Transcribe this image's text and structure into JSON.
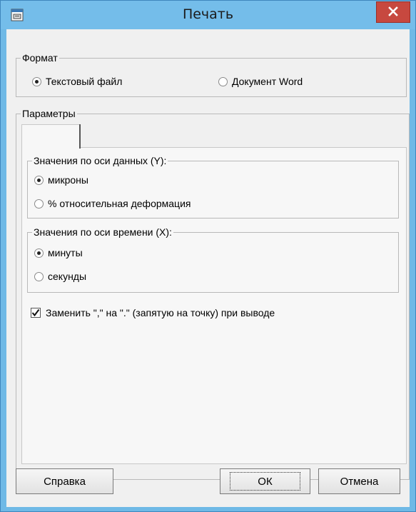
{
  "window": {
    "title": "Печать",
    "icon": "print-dialog-icon",
    "close_icon": "close-icon"
  },
  "format": {
    "legend": "Формат",
    "options": [
      {
        "label": "Текстовый файл",
        "checked": true
      },
      {
        "label": "Документ Word",
        "checked": false
      }
    ]
  },
  "params": {
    "legend": "Параметры",
    "y_group": {
      "legend": "Значения по оси данных (Y):",
      "options": [
        {
          "label": "микроны",
          "checked": true
        },
        {
          "label": "% относительная деформация",
          "checked": false
        }
      ]
    },
    "x_group": {
      "legend": "Значения по оси времени (X):",
      "options": [
        {
          "label": "минуты",
          "checked": true
        },
        {
          "label": "секунды",
          "checked": false
        }
      ]
    },
    "replace_checkbox": {
      "label": "Заменить \",\" на \".\" (запятую на точку) при выводе",
      "checked": true
    }
  },
  "buttons": {
    "help": "Справка",
    "ok": "ОК",
    "cancel": "Отмена"
  }
}
